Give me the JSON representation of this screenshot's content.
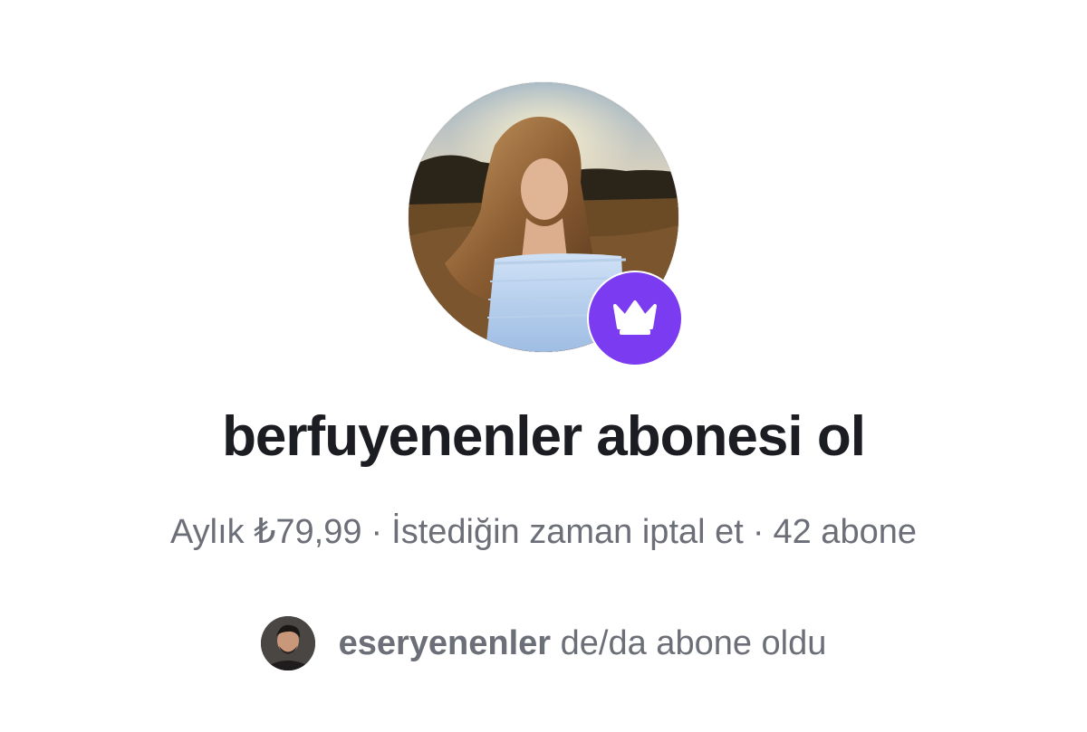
{
  "creator": {
    "avatar_alt": "profile-photo",
    "badge_icon": "crown-icon",
    "badge_color": "#7b3bf0"
  },
  "title": "berfuyenenler abonesi ol",
  "subscription": {
    "price_text": "Aylık ₺79,99",
    "separator": "·",
    "cancel_text": "İstediğin zaman iptal et",
    "subscribers_text": "42 abone"
  },
  "friend_activity": {
    "username": "eseryenenler",
    "action_text": "de/da abone oldu"
  }
}
